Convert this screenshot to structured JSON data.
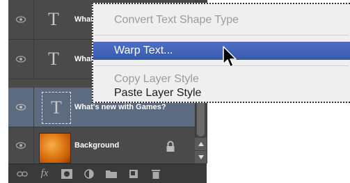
{
  "layers_panel": {
    "layers": [
      {
        "name": "What's new with Games?",
        "name_visible": "What",
        "type": "text",
        "visible": true,
        "selected": false
      },
      {
        "name": "What's new with Games?",
        "name_visible": "What",
        "type": "text",
        "visible": true,
        "selected": false
      },
      {
        "name": "What's new with Games?",
        "name_visible": "What's new with Games?",
        "type": "text",
        "visible": true,
        "selected": true
      },
      {
        "name": "Background",
        "name_visible": "Background",
        "type": "image",
        "visible": true,
        "selected": false,
        "locked": true
      }
    ],
    "text_thumb_glyph": "T",
    "footer_icons": [
      "link-icon",
      "fx-icon",
      "mask-icon",
      "adjustment-icon",
      "folder-icon",
      "new-layer-icon",
      "trash-icon"
    ],
    "footer_fx_label": "fx"
  },
  "context_menu": {
    "items": [
      {
        "label": "Convert Text Shape Type",
        "enabled": false,
        "highlighted": false
      },
      {
        "label": "Warp Text...",
        "enabled": true,
        "highlighted": true
      },
      {
        "label": "Copy Layer Style",
        "enabled": false,
        "highlighted": false
      },
      {
        "label": "Paste Layer Style",
        "enabled": true,
        "highlighted": false
      }
    ]
  },
  "colors": {
    "panel_bg": "#4a4a4a",
    "selected_row": "#5c6b7f",
    "menu_highlight": "#3f61b5"
  }
}
